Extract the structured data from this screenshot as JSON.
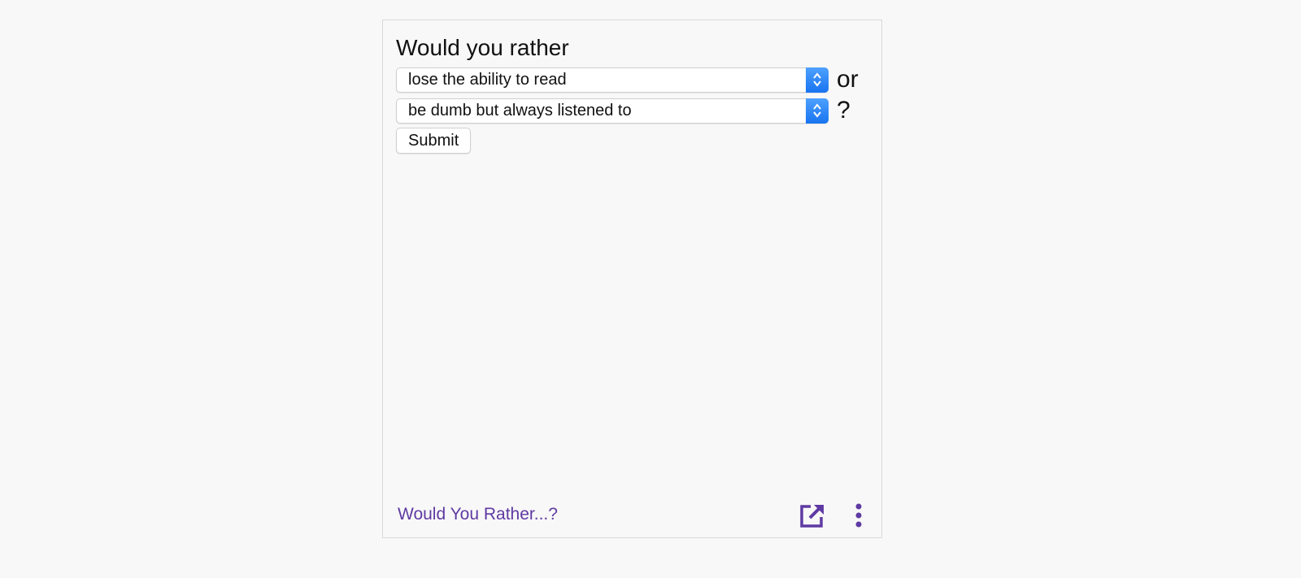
{
  "widget": {
    "title": "Would you rather",
    "option1": {
      "value": "lose the ability to read",
      "suffix": "or"
    },
    "option2": {
      "value": "be dumb but always listened to",
      "suffix": "?"
    },
    "submit_label": "Submit",
    "footer_link": "Would You Rather...?",
    "icons": {
      "open": "open-in-new-icon",
      "more": "more-vertical-icon"
    },
    "colors": {
      "accent": "#5f3aa3",
      "select_arrow": "#1874f0"
    }
  }
}
